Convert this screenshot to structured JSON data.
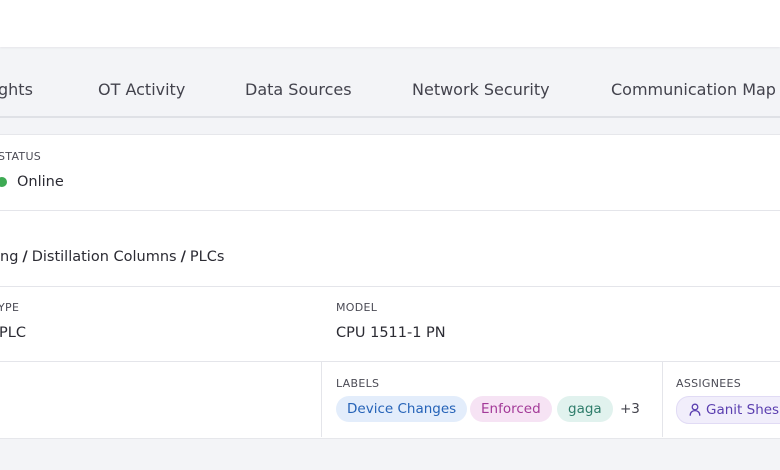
{
  "tabs": [
    "ghts",
    "OT Activity",
    "Data Sources",
    "Network Security",
    "Communication Map"
  ],
  "status": {
    "label": "STATUS",
    "value": "Online",
    "color": "#3daa53"
  },
  "breadcrumb": {
    "parts": [
      "ng",
      "Distillation Columns",
      "PLCs"
    ],
    "separator": "/"
  },
  "type": {
    "label": "YPE",
    "value": "PLC"
  },
  "model": {
    "label": "MODEL",
    "value": "CPU 1511-1 PN"
  },
  "labels": {
    "label": "LABELS",
    "items": [
      "Device Changes",
      "Enforced",
      "gaga"
    ],
    "more": "+3"
  },
  "assignees": {
    "label": "ASSIGNEES",
    "items": [
      "Ganit Shes"
    ],
    "icon": "user-icon"
  }
}
